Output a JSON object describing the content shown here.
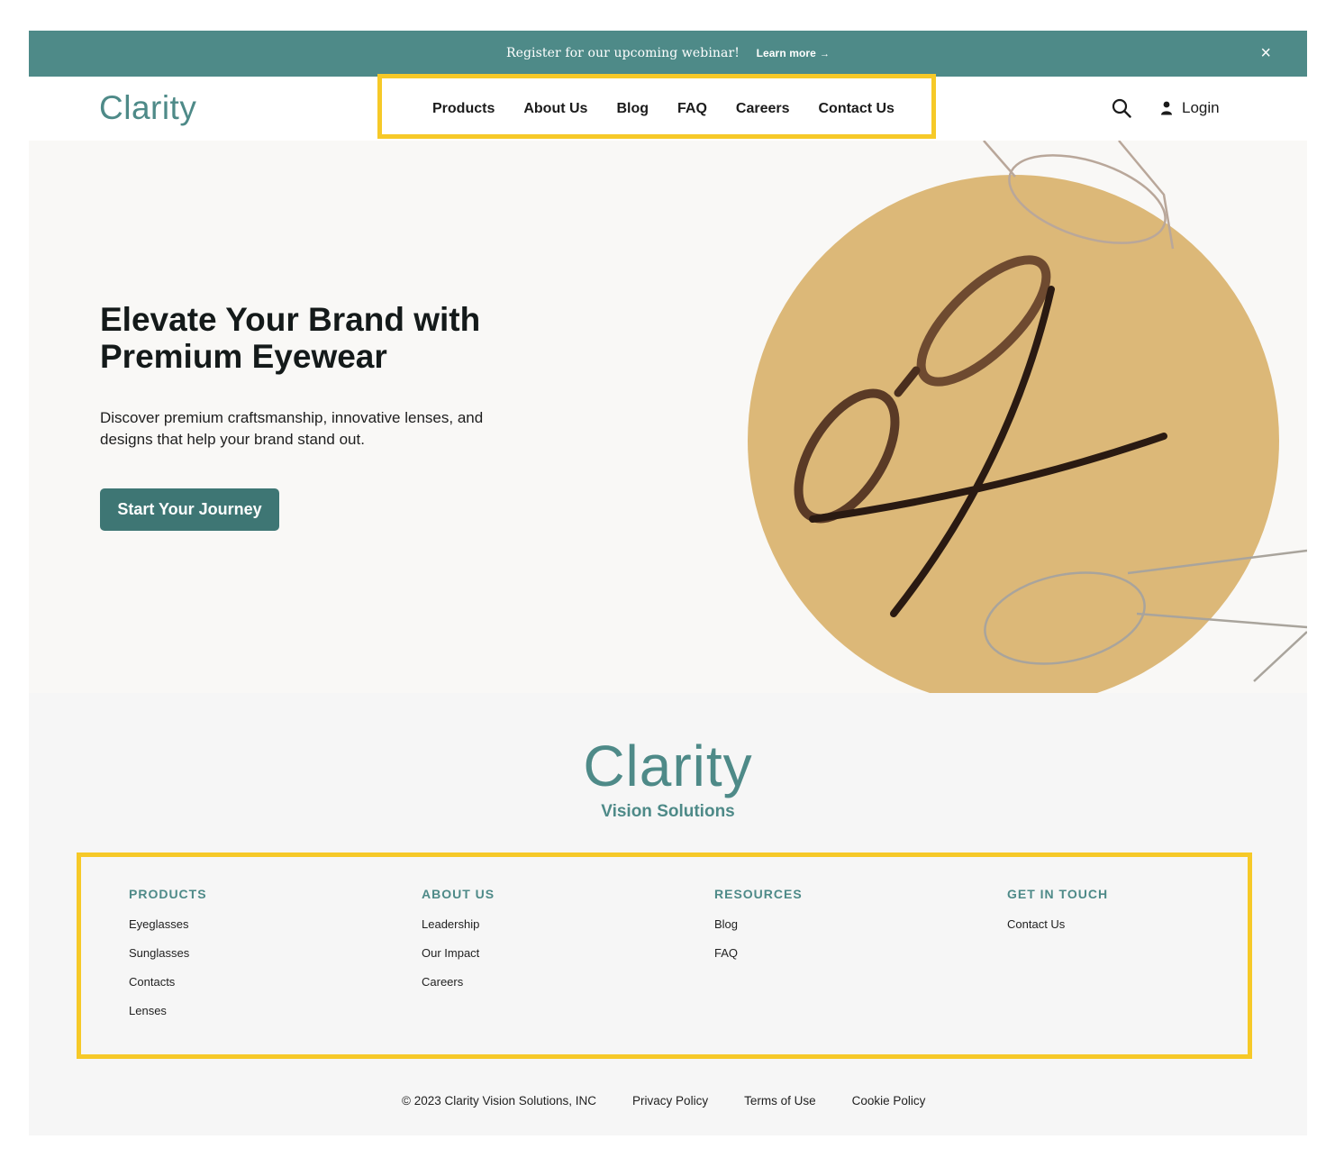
{
  "announcement": {
    "message": "Register for our upcoming webinar!",
    "link_label": "Learn more",
    "link_arrow": "→",
    "close_label": "×"
  },
  "header": {
    "logo": "Clarity",
    "nav": [
      "Products",
      "About Us",
      "Blog",
      "FAQ",
      "Careers",
      "Contact Us"
    ],
    "search_icon": "search-icon",
    "login_label": "Login",
    "login_icon": "user-icon"
  },
  "hero": {
    "title": "Elevate Your Brand with Premium Eyewear",
    "description": "Discover premium craftsmanship, innovative lenses, and designs that help your brand stand out.",
    "cta_label": "Start Your Journey",
    "circle_color": "#dcb878"
  },
  "footer": {
    "logo": "Clarity",
    "tagline": "Vision Solutions",
    "columns": [
      {
        "heading": "PRODUCTS",
        "links": [
          "Eyeglasses",
          "Sunglasses",
          "Contacts",
          "Lenses"
        ]
      },
      {
        "heading": "ABOUT US",
        "links": [
          "Leadership",
          "Our Impact",
          "Careers"
        ]
      },
      {
        "heading": "RESOURCES",
        "links": [
          "Blog",
          "FAQ"
        ]
      },
      {
        "heading": "GET IN TOUCH",
        "links": [
          "Contact Us"
        ]
      }
    ],
    "legal": {
      "copyright": "© 2023 Clarity Vision Solutions, INC",
      "privacy": "Privacy Policy",
      "terms": "Terms of Use",
      "cookie": "Cookie Policy"
    }
  },
  "colors": {
    "brand_teal": "#4e8a88",
    "button_teal": "#3e7674",
    "highlight_yellow": "#f6c928"
  }
}
